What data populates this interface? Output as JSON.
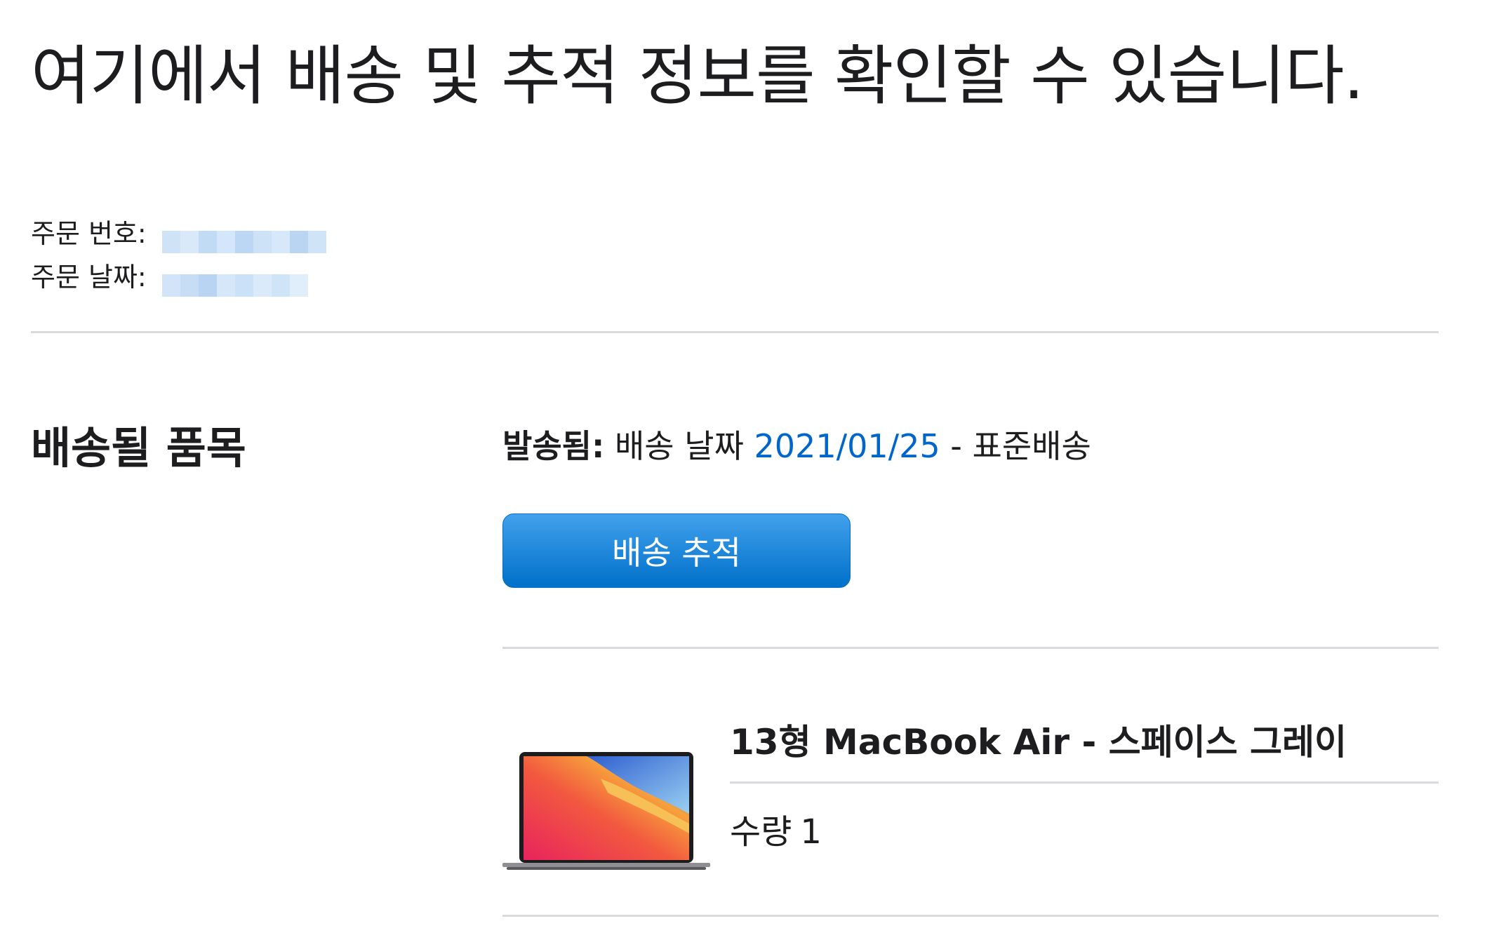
{
  "page": {
    "headline": "여기에서 배송 및 추적 정보를 확인할 수 있습니다."
  },
  "order": {
    "number_label": "주문 번호:",
    "date_label": "주문 날짜:"
  },
  "items_section": {
    "title": "배송될 품목",
    "status_bold": "발송됨:",
    "status_prefix": " 배송 날짜 ",
    "ship_date": "2021/01/25",
    "status_suffix": " - 표준배송",
    "track_button": "배송 추적"
  },
  "product": {
    "name": "13형 MacBook Air - 스페이스 그레이",
    "qty_label": "수량",
    "qty_value": "1"
  },
  "colors": {
    "accent": "#0066cc",
    "button_top": "#42a1ec",
    "button_bottom": "#0070c9",
    "divider": "#d9d9de",
    "text": "#1d1d1f"
  }
}
